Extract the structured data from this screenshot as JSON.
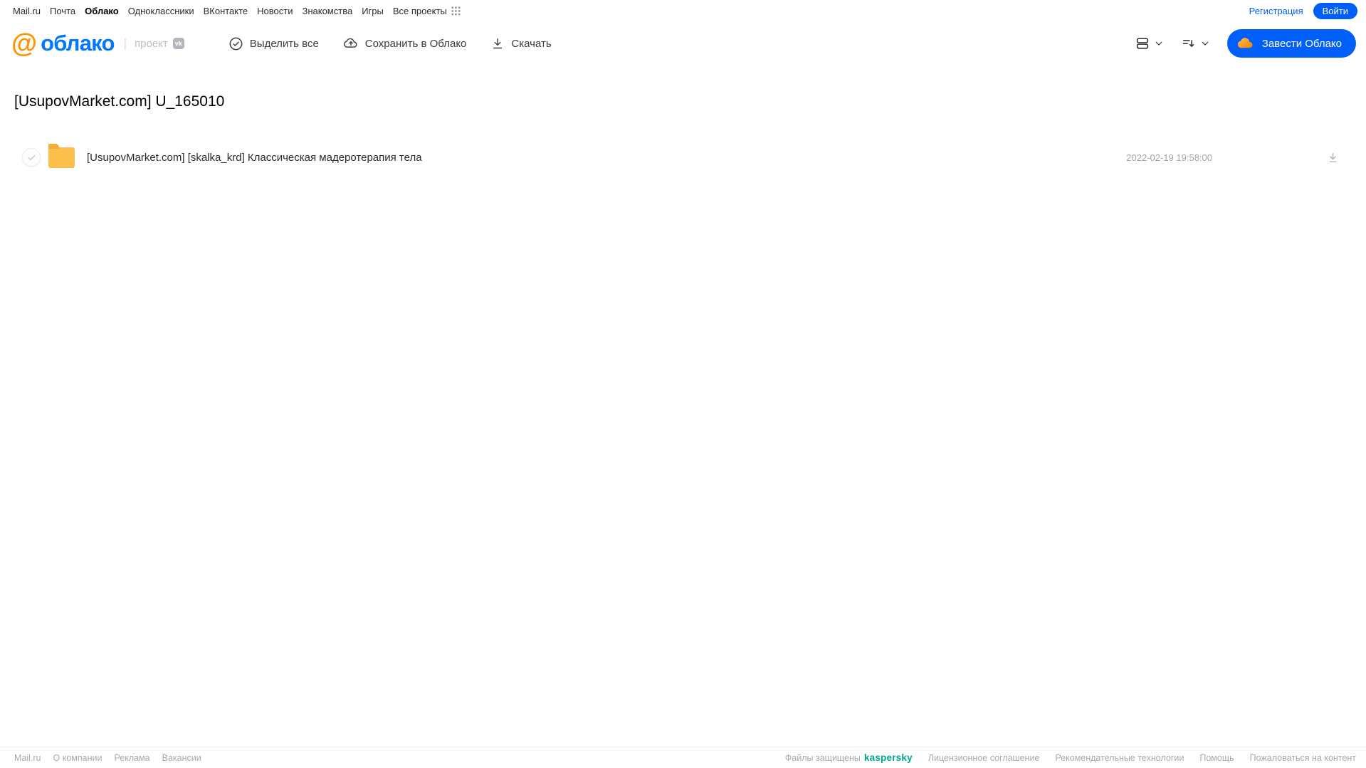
{
  "topnav": {
    "links": [
      "Mail.ru",
      "Почта",
      "Облако",
      "Одноклассники",
      "ВКонтакте",
      "Новости",
      "Знакомства",
      "Игры",
      "Все проекты"
    ],
    "active_link": "Облако",
    "registration": "Регистрация",
    "login": "Войти"
  },
  "header": {
    "logo_text": "облако",
    "project_label": "проект",
    "toolbar": {
      "select_all": "Выделить все",
      "save_to_cloud": "Сохранить в Облако",
      "download": "Скачать"
    },
    "create_cloud": "Завести Облако"
  },
  "main": {
    "title": "[UsupovMarket.com] U_165010",
    "files": [
      {
        "type": "folder",
        "name": "[UsupovMarket.com] [skalka_krd] Классическая мадеротерапия тела",
        "modified": "2022-02-19 19:58:00"
      }
    ]
  },
  "footer": {
    "left_links": [
      "Mail.ru",
      "О компании",
      "Реклама",
      "Вакансии"
    ],
    "protected_by": "Файлы защищены",
    "kaspersky": "kaspersky",
    "right_links": [
      "Лицензионное соглашение",
      "Рекомендательные технологии",
      "Помощь",
      "Пожаловаться на контент"
    ]
  },
  "icons": {
    "at_symbol": "@",
    "vk_badge": "vk"
  },
  "colors": {
    "accent_blue": "#005ff9",
    "logo_blue": "#0077ff",
    "logo_orange": "#ff9500",
    "folder_yellow": "#fcbf4b",
    "kaspersky_teal": "#00a88e",
    "gray_text": "#a9a9a9"
  }
}
